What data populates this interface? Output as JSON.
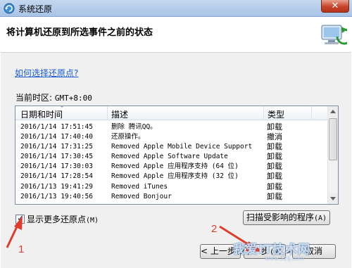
{
  "window": {
    "title": "系统还原",
    "close_glyph": "✕"
  },
  "header": {
    "heading": "将计算机还原到所选事件之前的状态"
  },
  "help_link": "如何选择还原点?",
  "timezone": {
    "label": "当前时区:",
    "value": "GMT+8:00"
  },
  "table": {
    "columns": [
      "日期和时间",
      "描述",
      "类型"
    ],
    "rows": [
      {
        "date": "2016/1/14 17:51:45",
        "desc": "删除 腾讯QQ。",
        "type": "卸载"
      },
      {
        "date": "2016/1/14 17:40:40",
        "desc": "还原操作。",
        "type": "撤消"
      },
      {
        "date": "2016/1/14 17:31:25",
        "desc": "Removed Apple Mobile Device Support",
        "type": "卸载"
      },
      {
        "date": "2016/1/14 17:30:45",
        "desc": "Removed Apple Software Update",
        "type": "卸载"
      },
      {
        "date": "2016/1/14 17:30:03",
        "desc": "Removed Apple 应用程序支持 (64 位)",
        "type": "卸载"
      },
      {
        "date": "2016/1/14 17:28:54",
        "desc": "Removed Apple 应用程序支持 (32 位)",
        "type": "卸载"
      },
      {
        "date": "2016/1/13 19:41:29",
        "desc": "Removed iTunes",
        "type": "卸载"
      },
      {
        "date": "2016/1/13 19:40:56",
        "desc": "Removed Bonjour",
        "type": "卸载"
      }
    ]
  },
  "show_more": {
    "checked": true,
    "label": "显示更多还原点",
    "accel": "(M)"
  },
  "buttons": {
    "scan": "扫描受影响的程序",
    "scan_accel": "(A)",
    "back": "< 上一步",
    "back_accel": "(B)",
    "next": "下一步",
    "next_accel": "(N) >",
    "cancel": "取消"
  },
  "annotations": {
    "step1": "1",
    "step2": "2",
    "watermark": "我爱IT技术网",
    "watermark_sub": "www.52ij.com",
    "color": "#e03c2d"
  }
}
